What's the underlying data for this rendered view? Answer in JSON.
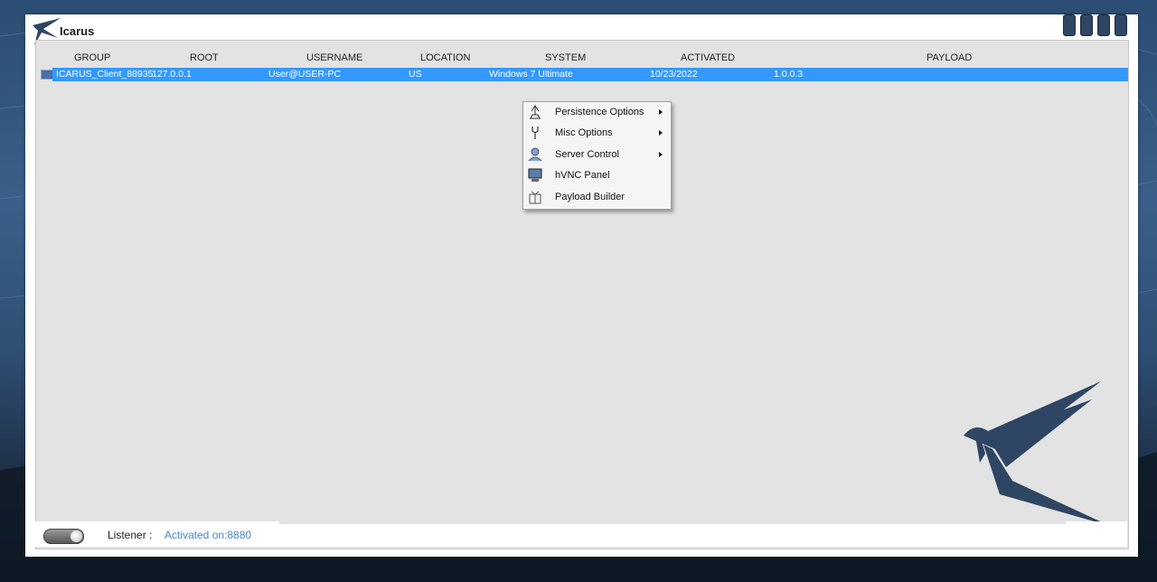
{
  "app": {
    "title": "Icarus"
  },
  "table": {
    "columns": [
      "GROUP",
      "ROOT",
      "USERNAME",
      "LOCATION",
      "SYSTEM",
      "ACTIVATED",
      "PAYLOAD"
    ],
    "rows": [
      {
        "group": "ICARUS_Client_88935",
        "root": "127.0.0.1",
        "username": "User@USER-PC",
        "location": "US",
        "system": "Windows 7 Ultimate",
        "activated": "10/23/2022",
        "payload": "1.0.0.3"
      }
    ]
  },
  "context_menu": {
    "items": [
      {
        "label": "Persistence Options",
        "icon": "persistence-icon",
        "submenu": true
      },
      {
        "label": "Misc Options",
        "icon": "tools-icon",
        "submenu": true
      },
      {
        "label": "Server Control",
        "icon": "server-control-icon",
        "submenu": true
      },
      {
        "label": "hVNC Panel",
        "icon": "monitor-icon",
        "submenu": false
      },
      {
        "label": "Payload Builder",
        "icon": "payload-icon",
        "submenu": false
      }
    ]
  },
  "status": {
    "listener_label": "Listener :",
    "listener_value": "Activated on:8880"
  },
  "colors": {
    "selection": "#3399ff",
    "accent_text": "#4a86c8",
    "brand_navy": "#2f4564"
  }
}
